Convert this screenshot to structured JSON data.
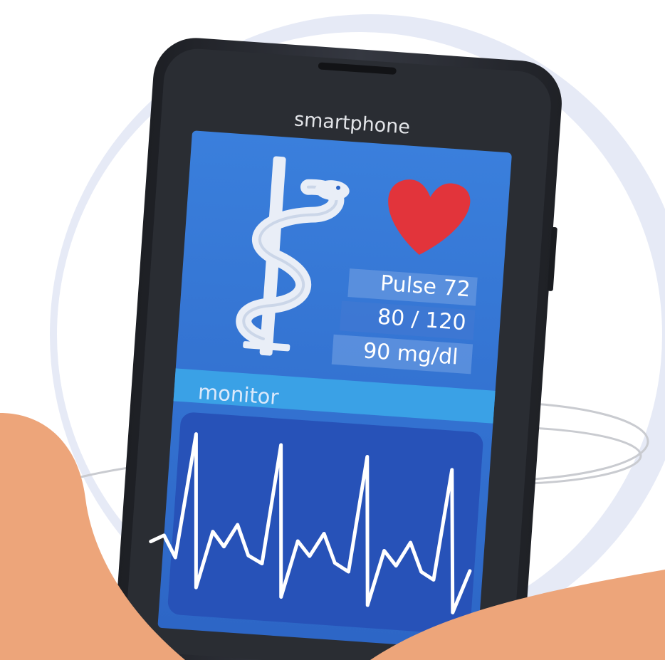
{
  "device": {
    "brand_label": "smartphone"
  },
  "screen": {
    "readouts": [
      {
        "id": "pulse",
        "text": "Pulse 72"
      },
      {
        "id": "blood-pressure",
        "text": "80 / 120"
      },
      {
        "id": "glucose",
        "text": "90 mg/dl"
      }
    ],
    "section_label": "monitor"
  },
  "icons": [
    "caduceus-icon",
    "heart-icon",
    "ecg-waveform-icon"
  ],
  "colors": {
    "background_circle": "#e6eaf6",
    "accent_orange": "#eda57a",
    "phone_body": "#2a2d33",
    "screen_blue": "#2f6fd0",
    "heart_red": "#e2343b",
    "readout_band": "#5b8fdc",
    "monitor_bar": "#3aa1e6",
    "waveform_panel": "#2752b8"
  }
}
